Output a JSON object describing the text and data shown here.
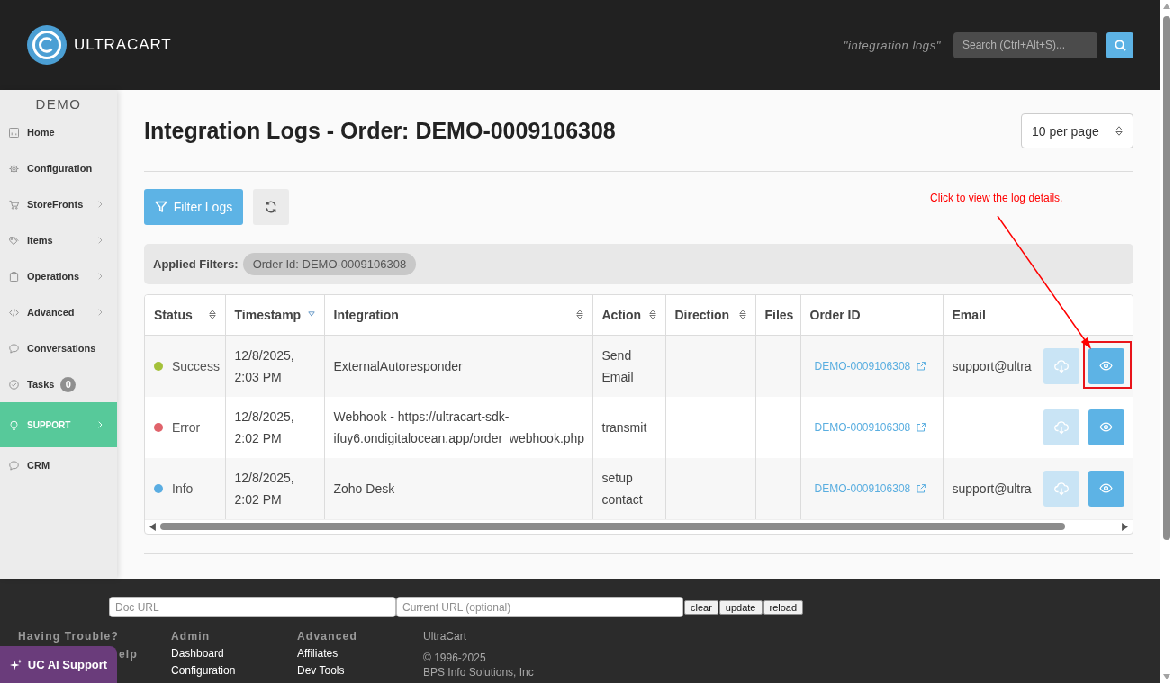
{
  "header": {
    "brand": "ULTRACART",
    "saved_search": "\"integration logs\"",
    "search": {
      "placeholder": "Search (Ctrl+Alt+S)..."
    }
  },
  "sidebar": {
    "account": "DEMO",
    "items": [
      {
        "label": "Home",
        "selected": false,
        "expandable": false
      },
      {
        "label": "Configuration",
        "selected": false,
        "expandable": false
      },
      {
        "label": "StoreFronts",
        "selected": false,
        "expandable": true
      },
      {
        "label": "Items",
        "selected": false,
        "expandable": true
      },
      {
        "label": "Operations",
        "selected": false,
        "expandable": true
      },
      {
        "label": "Advanced",
        "selected": false,
        "expandable": true
      },
      {
        "label": "Conversations",
        "selected": false,
        "expandable": false
      },
      {
        "label": "Tasks",
        "selected": false,
        "expandable": false,
        "badge": "0"
      },
      {
        "label": "SUPPORT",
        "selected": true,
        "expandable": true
      },
      {
        "label": "CRM",
        "selected": false,
        "expandable": false
      }
    ]
  },
  "page": {
    "title": "Integration Logs - Order: DEMO-0009106308",
    "page_size": "10 per page",
    "filter_button": "Filter Logs",
    "applied_filters": {
      "label": "Applied Filters:",
      "chips": [
        "Order Id: DEMO-0009106308"
      ]
    }
  },
  "annotation": {
    "text": "Click to view the log details."
  },
  "table": {
    "columns": [
      {
        "label": "Status",
        "sortable": true,
        "sorted": false
      },
      {
        "label": "Timestamp",
        "sortable": true,
        "sorted": true
      },
      {
        "label": "Integration",
        "sortable": true,
        "sorted": false
      },
      {
        "label": "Action",
        "sortable": true,
        "sorted": false
      },
      {
        "label": "Direction",
        "sortable": true,
        "sorted": false
      },
      {
        "label": "Files",
        "sortable": false,
        "sorted": false
      },
      {
        "label": "Order ID",
        "sortable": false,
        "sorted": false
      },
      {
        "label": "Email",
        "sortable": false,
        "sorted": false
      }
    ],
    "rows": [
      {
        "status": "Success",
        "color": "#a4c13a",
        "timestamp": "12/8/2025, 2:03 PM",
        "integration": "ExternalAutoresponder",
        "action": "Send Email",
        "order_id": "DEMO-0009106308",
        "email": "support@ultra",
        "download_disabled": true,
        "highlighted": true
      },
      {
        "status": "Error",
        "color": "#e0636b",
        "timestamp": "12/8/2025, 2:02 PM",
        "integration": "Webhook - https://ultracart-sdk-ifuy6.ondigitalocean.app/order_webhook.php",
        "action": "transmit",
        "order_id": "DEMO-0009106308",
        "download_disabled": true,
        "highlighted": false
      },
      {
        "status": "Info",
        "color": "#5aade2",
        "timestamp": "12/8/2025, 2:02 PM",
        "integration": "Zoho Desk",
        "action": "setup contact",
        "order_id": "DEMO-0009106308",
        "email": "support@ultra",
        "download_disabled": true,
        "highlighted": false
      }
    ]
  },
  "footer": {
    "doc_url": {
      "placeholder": "Doc URL"
    },
    "current_url": {
      "placeholder": "Current URL (optional)"
    },
    "buttons": [
      "clear",
      "update",
      "reload"
    ],
    "columns": [
      {
        "headings": [
          "Having Trouble?",
          "elp"
        ]
      },
      {
        "headings": [
          "Admin"
        ],
        "links": [
          "Dashboard",
          "Configuration"
        ]
      },
      {
        "headings": [
          "Advanced"
        ],
        "links": [
          "Affiliates",
          "Dev Tools"
        ]
      }
    ],
    "company": [
      "UltraCart",
      "© 1996-2025",
      "BPS Info Solutions, Inc"
    ],
    "assistant_button": "UC AI Support"
  }
}
